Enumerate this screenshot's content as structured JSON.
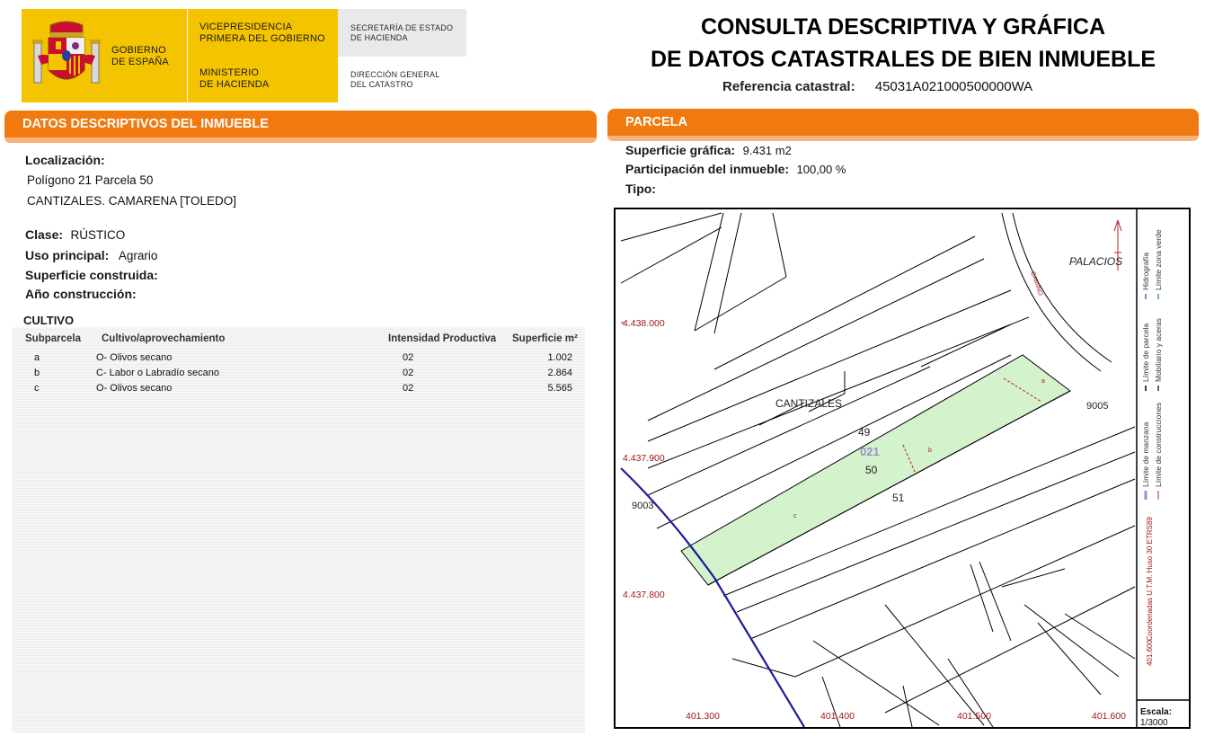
{
  "header": {
    "gob_line1": "GOBIERNO",
    "gob_line2": "DE ESPAÑA",
    "vice_line1": "VICEPRESIDENCIA",
    "vice_line2": "PRIMERA DEL GOBIERNO",
    "min_line1": "MINISTERIO",
    "min_line2": "DE HACIENDA",
    "sec_line1": "SECRETARÍA DE ESTADO",
    "sec_line2": "DE HACIENDA",
    "dir_line1": "DIRECCIÓN GENERAL",
    "dir_line2": "DEL CATASTRO",
    "title_line1": "CONSULTA DESCRIPTIVA Y GRÁFICA",
    "title_line2": "DE DATOS CATASTRALES DE BIEN INMUEBLE",
    "ref_label": "Referencia catastral:",
    "ref_value": "45031A021000500000WA"
  },
  "left": {
    "panel_title": "DATOS DESCRIPTIVOS DEL INMUEBLE",
    "loc_label": "Localización:",
    "loc_line1": "Polígono 21 Parcela 50",
    "loc_line2": "CANTIZALES. CAMARENA [TOLEDO]",
    "clase_label": "Clase:",
    "clase_value": "RÚSTICO",
    "uso_label": "Uso principal:",
    "uso_value": "Agrario",
    "sup_label": "Superficie construida:",
    "anio_label": "Año construcción:",
    "cultivo_title": "CULTIVO",
    "columns": [
      "Subparcela",
      "Cultivo/aprovechamiento",
      "Intensidad Productiva",
      "Superficie m²"
    ],
    "rows": [
      {
        "sub": "a",
        "cultivo": "O- Olivos secano",
        "intensidad": "02",
        "superficie": "1.002"
      },
      {
        "sub": "b",
        "cultivo": "C- Labor o Labradío secano",
        "intensidad": "02",
        "superficie": "2.864"
      },
      {
        "sub": "c",
        "cultivo": "O- Olivos secano",
        "intensidad": "02",
        "superficie": "5.565"
      }
    ]
  },
  "right": {
    "panel_title": "PARCELA",
    "sup_label": "Superficie gráfica:",
    "sup_value": "9.431 m2",
    "part_label": "Participación del inmueble:",
    "part_value": "100,00 %",
    "tipo_label": "Tipo:"
  },
  "map": {
    "place_palacios": "PALACIOS",
    "road_label": "CAMINO",
    "place_cantizales": "CANTIZALES",
    "parcel_49": "49",
    "parcel_50": "50",
    "parcel_51": "51",
    "polygon_label": "021",
    "sub_a": "a",
    "sub_b": "b",
    "sub_c": "c",
    "code_9005": "9005",
    "code_9003": "9003",
    "y_coords": [
      "4.438.000",
      "4.437.900",
      "4.437.800"
    ],
    "x_coords": [
      "401.300",
      "401.400",
      "401.500",
      "401.600"
    ],
    "legend": {
      "hidrografia": "Hidrografía",
      "zona_verde": "Límite zona verde",
      "limite_parcela": "Límite de parcela",
      "mobiliario": "Mobiliario y aceras",
      "limite_manzana": "Límite de manzana",
      "limite_construcciones": "Límite de construcciones",
      "coords_note": "Coordenadas U.T.M. Huso 30 ETRS89",
      "coord_ref": "401.600"
    },
    "scale_label": "Escala:",
    "scale_value": "1/3000",
    "colors": {
      "parcel_fill": "#d4f2cc",
      "coord_red": "#a01818",
      "boundary_blue": "#1c1c9a"
    }
  }
}
